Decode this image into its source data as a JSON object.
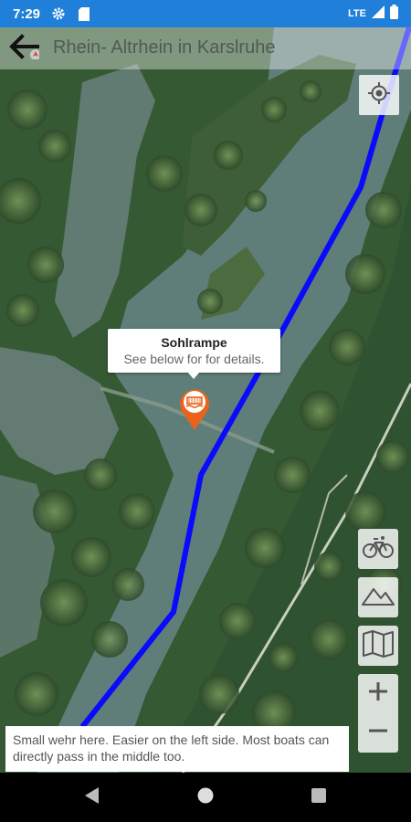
{
  "status": {
    "time": "7:29",
    "left_icons": [
      "gear-icon",
      "sd-card-icon"
    ],
    "network": "LTE",
    "right_icons": [
      "signal-icon",
      "battery-icon"
    ]
  },
  "toolbar": {
    "title": "Rhein- Altrhein in Karslruhe",
    "back_icon": "arrow-left-icon"
  },
  "map": {
    "route_color": "#0a0aff",
    "locate_icon": "crosshair-icon",
    "popup": {
      "title": "Sohlrampe",
      "subtitle": "See below for for details."
    },
    "marker": {
      "icon": "weir-icon",
      "color": "#e8641c"
    }
  },
  "controls": {
    "items": [
      "bicycle-icon",
      "mountain-icon",
      "map-icon"
    ],
    "zoom_in": "+",
    "zoom_out": "−"
  },
  "description": "Small wehr here. Easier on the left side. Most boats can directly pass in the middle too.",
  "navbar": {
    "icons": [
      "back-triangle-icon",
      "home-circle-icon",
      "recents-square-icon"
    ]
  }
}
